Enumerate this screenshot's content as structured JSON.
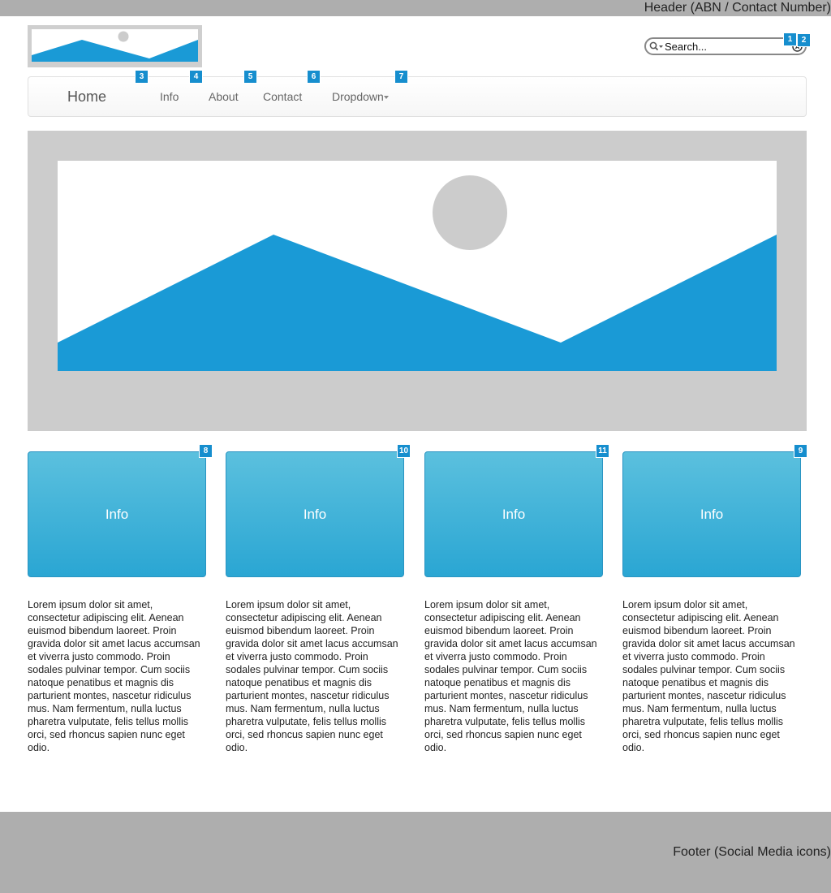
{
  "header": {
    "text": "Header (ABN / Contact Number)"
  },
  "search": {
    "placeholder": "Search..."
  },
  "nav": {
    "brand": "Home",
    "items": [
      {
        "label": "Info"
      },
      {
        "label": "About"
      },
      {
        "label": "Contact"
      },
      {
        "label": "Dropdown"
      }
    ]
  },
  "annotations": [
    "1",
    "2",
    "3",
    "4",
    "5",
    "6",
    "7",
    "8",
    "10",
    "11",
    "9"
  ],
  "tiles": [
    {
      "label": "Info",
      "text": "Lorem ipsum dolor sit amet, consectetur adipiscing elit. Aenean euismod bibendum laoreet. Proin gravida dolor sit amet lacus accumsan et viverra justo commodo. Proin sodales pulvinar tempor. Cum sociis natoque penatibus et magnis dis parturient montes, nascetur ridiculus mus. Nam fermentum, nulla luctus pharetra vulputate, felis tellus mollis orci, sed rhoncus sapien nunc eget odio."
    },
    {
      "label": "Info",
      "text": "Lorem ipsum dolor sit amet, consectetur adipiscing elit. Aenean euismod bibendum laoreet. Proin gravida dolor sit amet lacus accumsan et viverra justo commodo. Proin sodales pulvinar tempor. Cum sociis natoque penatibus et magnis dis parturient montes, nascetur ridiculus mus. Nam fermentum, nulla luctus pharetra vulputate, felis tellus mollis orci, sed rhoncus sapien nunc eget odio."
    },
    {
      "label": "Info",
      "text": "Lorem ipsum dolor sit amet, consectetur adipiscing elit. Aenean euismod bibendum laoreet. Proin gravida dolor sit amet lacus accumsan et viverra justo commodo. Proin sodales pulvinar tempor. Cum sociis natoque penatibus et magnis dis parturient montes, nascetur ridiculus mus. Nam fermentum, nulla luctus pharetra vulputate, felis tellus mollis orci, sed rhoncus sapien nunc eget odio."
    },
    {
      "label": "Info",
      "text": "Lorem ipsum dolor sit amet, consectetur adipiscing elit. Aenean euismod bibendum laoreet. Proin gravida dolor sit amet lacus accumsan et viverra justo commodo. Proin sodales pulvinar tempor. Cum sociis natoque penatibus et magnis dis parturient montes, nascetur ridiculus mus. Nam fermentum, nulla luctus pharetra vulputate, felis tellus mollis orci, sed rhoncus sapien nunc eget odio."
    }
  ],
  "footer": {
    "text": "Footer (Social Media icons)"
  },
  "colors": {
    "accent": "#1a9ad6",
    "tile_top": "#5bc0de",
    "tile_bottom": "#2aa6d3",
    "placeholder_gray": "#cccccc",
    "bar_gray": "#aeaeae",
    "badge": "#168ece"
  },
  "icons": {
    "search": "search-icon",
    "clear": "clear-icon",
    "dropdown": "chevron-down-icon",
    "logo": "image-placeholder-icon",
    "hero": "image-placeholder-icon"
  }
}
